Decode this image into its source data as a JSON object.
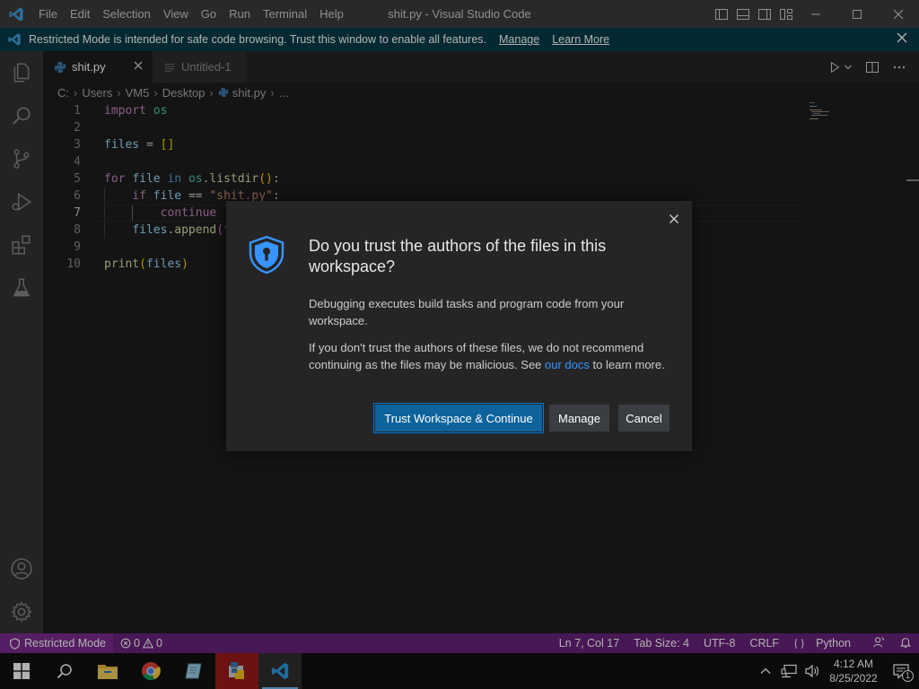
{
  "window": {
    "title": "shit.py - Visual Studio Code",
    "menu": [
      "File",
      "Edit",
      "Selection",
      "View",
      "Go",
      "Run",
      "Terminal",
      "Help"
    ]
  },
  "banner": {
    "text": "Restricted Mode is intended for safe code browsing. Trust this window to enable all features.",
    "manage": "Manage",
    "learn_more": "Learn More"
  },
  "tabs": [
    {
      "label": "shit.py",
      "active": true
    },
    {
      "label": "Untitled-1",
      "active": false
    }
  ],
  "breadcrumb": [
    "C:",
    "Users",
    "VM5",
    "Desktop",
    "shit.py",
    "..."
  ],
  "editor": {
    "line_numbers": [
      "1",
      "2",
      "3",
      "4",
      "5",
      "6",
      "7",
      "8",
      "9",
      "10"
    ],
    "current_line": 7
  },
  "dialog": {
    "title": "Do you trust the authors of the files in this workspace?",
    "paragraph1": "Debugging executes build tasks and program code from your workspace.",
    "paragraph2_before": "If you don't trust the authors of these files, we do not recommend continuing as the files may be malicious. See ",
    "paragraph2_link": "our docs",
    "paragraph2_after": " to learn more.",
    "trust_button": "Trust Workspace & Continue",
    "manage_button": "Manage",
    "cancel_button": "Cancel"
  },
  "statusbar": {
    "restricted": "Restricted Mode",
    "errors": "0",
    "warnings": "0",
    "position": "Ln 7, Col 17",
    "tab_size": "Tab Size: 4",
    "encoding": "UTF-8",
    "eol": "CRLF",
    "language": "Python"
  },
  "taskbar": {
    "time": "4:12 AM",
    "date": "8/25/2022",
    "notifications": "1"
  },
  "colors": {
    "statusbar": "#68217a",
    "banner": "#063b49",
    "primary_button": "#0e639c",
    "link": "#3794ff"
  }
}
